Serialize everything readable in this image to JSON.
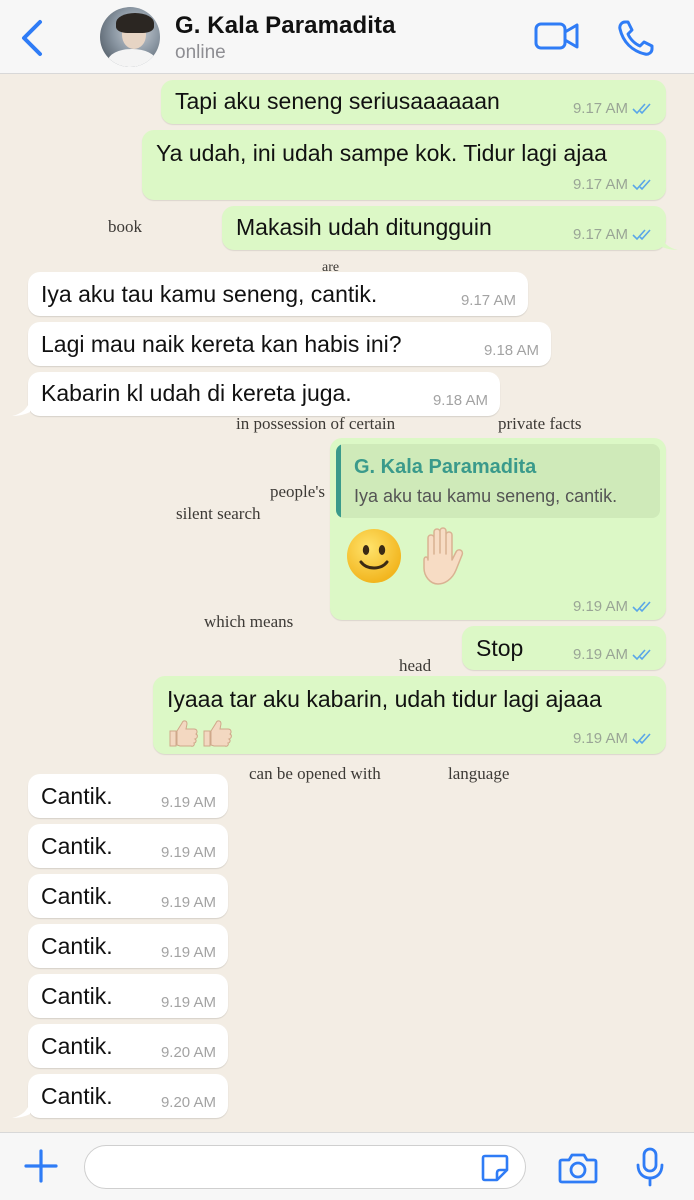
{
  "header": {
    "contact_name": "G. Kala Paramadita",
    "status": "online"
  },
  "background_text": [
    "book",
    "are",
    "in possession of certain",
    "private facts",
    "people's",
    "silent search",
    "which means",
    "head",
    "can be opened with",
    "language"
  ],
  "messages": [
    {
      "dir": "out",
      "text": "Tapi aku seneng seriusaaaaaan",
      "time": "9.17 AM"
    },
    {
      "dir": "out",
      "text": "Ya udah, ini udah sampe kok. Tidur lagi ajaa",
      "time": "9.17 AM"
    },
    {
      "dir": "out",
      "text": "Makasih udah ditungguin",
      "time": "9.17 AM"
    },
    {
      "dir": "in",
      "text": "Iya aku tau kamu seneng, cantik.",
      "time": "9.17 AM"
    },
    {
      "dir": "in",
      "text": "Lagi mau naik kereta kan habis ini?",
      "time": "9.18 AM"
    },
    {
      "dir": "in",
      "text": "Kabarin kl udah di kereta juga.",
      "time": "9.18 AM"
    },
    {
      "dir": "out",
      "reply_to_name": "G. Kala Paramadita",
      "reply_to_text": "Iya aku tau kamu seneng, cantik.",
      "emojis": [
        "slightly-smiling-face-emoji",
        "raised-hand-emoji"
      ],
      "time": "9.19 AM"
    },
    {
      "dir": "out",
      "text": "Stop",
      "time": "9.19 AM"
    },
    {
      "dir": "out",
      "text": "Iyaaa tar aku kabarin, udah tidur lagi ajaaa",
      "emojis": [
        "thumbs-up-emoji",
        "thumbs-up-emoji"
      ],
      "time": "9.19 AM"
    },
    {
      "dir": "in",
      "text": "Cantik.",
      "time": "9.19 AM"
    },
    {
      "dir": "in",
      "text": "Cantik.",
      "time": "9.19 AM"
    },
    {
      "dir": "in",
      "text": "Cantik.",
      "time": "9.19 AM"
    },
    {
      "dir": "in",
      "text": "Cantik.",
      "time": "9.19 AM"
    },
    {
      "dir": "in",
      "text": "Cantik.",
      "time": "9.19 AM"
    },
    {
      "dir": "in",
      "text": "Cantik.",
      "time": "9.20 AM"
    },
    {
      "dir": "in",
      "text": "Cantik.",
      "time": "9.20 AM"
    }
  ],
  "composer": {
    "value": ""
  },
  "colors": {
    "accent": "#2f7cf6",
    "outgoing_bubble": "#dcf8c6",
    "incoming_bubble": "#ffffff",
    "chat_background": "#f3ede4",
    "read_ticks": "#5aa6e8",
    "quote_accent": "#3a9a8b"
  },
  "icons": {
    "back": "chevron-left-icon",
    "video": "video-camera-icon",
    "call": "phone-icon",
    "add": "plus-icon",
    "sticker": "sticker-icon",
    "camera": "camera-icon",
    "mic": "microphone-icon"
  }
}
